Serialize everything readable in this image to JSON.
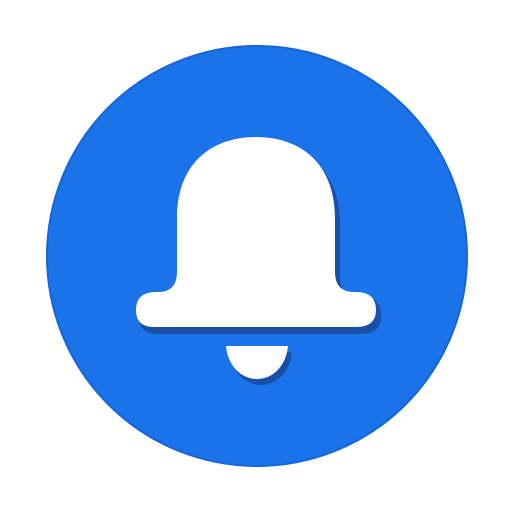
{
  "icon": {
    "name": "notification-bell-icon",
    "background_color": "#1A73E8",
    "edge_color": "#1565D8",
    "bell_color": "#FFFFFF",
    "shadow_color": "#174EA6"
  }
}
